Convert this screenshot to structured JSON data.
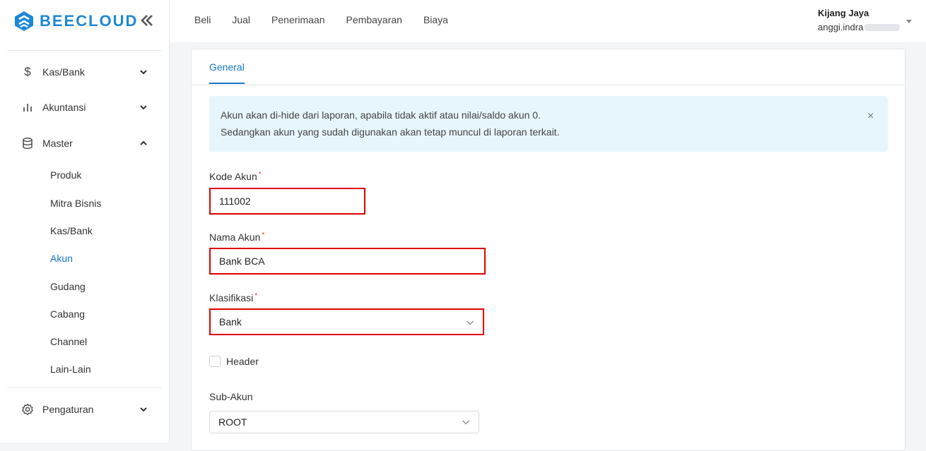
{
  "brand": {
    "name": "BEECLOUD",
    "color": "#1e88d8"
  },
  "sidebar": {
    "collapse_icon": "double-chevron-left-icon",
    "items": [
      {
        "label": "Kas/Bank",
        "icon": "dollar-icon"
      },
      {
        "label": "Akuntansi",
        "icon": "bar-chart-icon"
      },
      {
        "label": "Master",
        "icon": "database-icon"
      },
      {
        "label": "Pengaturan",
        "icon": "gear-icon"
      }
    ],
    "master_sub": [
      "Produk",
      "Mitra Bisnis",
      "Kas/Bank",
      "Akun",
      "Gudang",
      "Cabang",
      "Channel",
      "Lain-Lain"
    ],
    "active_sub": "Akun"
  },
  "topnav": [
    "Beli",
    "Jual",
    "Penerimaan",
    "Pembayaran",
    "Biaya"
  ],
  "user": {
    "company": "Kijang Jaya",
    "email": "anggi.indra"
  },
  "tab": {
    "label": "General"
  },
  "alert": {
    "line1": "Akun akan di-hide dari laporan, apabila tidak aktif atau nilai/saldo akun 0.",
    "line2": "Sedangkan akun yang sudah digunakan akan tetap muncul di laporan terkait.",
    "close": "×"
  },
  "form": {
    "kode_akun": {
      "label": "Kode Akun",
      "value": "111002"
    },
    "nama_akun": {
      "label": "Nama Akun",
      "value": "Bank BCA"
    },
    "klasifikasi": {
      "label": "Klasifikasi",
      "value": "Bank"
    },
    "header": {
      "label": "Header",
      "checked": false
    },
    "sub_akun": {
      "label": "Sub-Akun",
      "value": "ROOT"
    },
    "required_mark": "*"
  },
  "colors": {
    "accent": "#1677c8",
    "highlight": "#e00000",
    "alert_bg": "#e6f6fc"
  }
}
